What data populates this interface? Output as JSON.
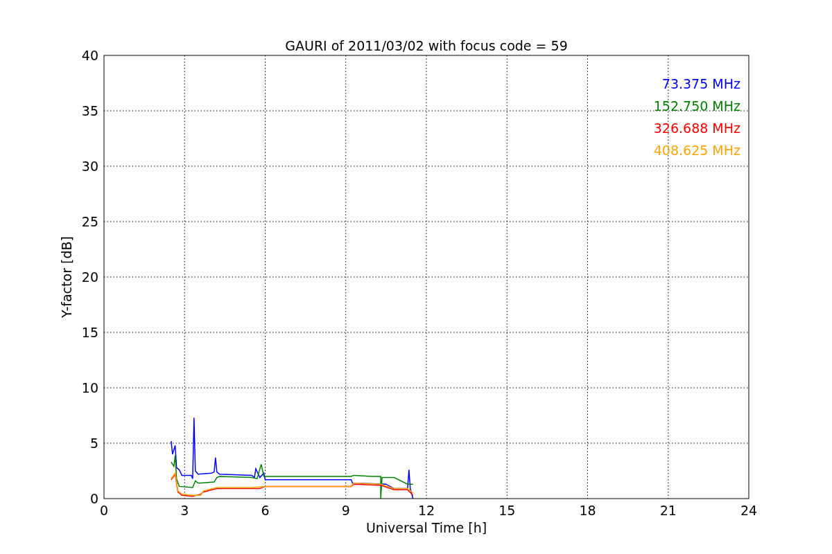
{
  "chart_data": {
    "type": "line",
    "title": "GAURI of 2011/03/02 with focus code = 59",
    "xlabel": "Universal Time [h]",
    "ylabel": "Y-factor [dB]",
    "xlim": [
      0,
      24
    ],
    "ylim": [
      0,
      40
    ],
    "xticks": [
      0,
      3,
      6,
      9,
      12,
      15,
      18,
      21,
      24
    ],
    "yticks": [
      0,
      5,
      10,
      15,
      20,
      25,
      30,
      35,
      40
    ],
    "grid": true,
    "series": [
      {
        "name": "73.375 MHz",
        "color": "#0000ff",
        "x": [
          2.5,
          2.55,
          2.65,
          2.7,
          2.8,
          2.9,
          3.25,
          3.3,
          3.35,
          3.4,
          3.5,
          4.0,
          4.1,
          4.15,
          4.2,
          4.3,
          5.5,
          5.6,
          5.65,
          5.8,
          5.95,
          6.0,
          9.2,
          9.25,
          10.5,
          10.8,
          11.3,
          11.35,
          11.4,
          11.5
        ],
        "values": [
          5.2,
          4,
          4.8,
          2.8,
          2.6,
          2.1,
          2.1,
          1.8,
          7.3,
          2.5,
          2.2,
          2.3,
          2.4,
          3.7,
          2.4,
          2.2,
          2.1,
          1.9,
          2.7,
          1.9,
          2.3,
          1.7,
          1.7,
          1.4,
          1.3,
          0.9,
          0.9,
          2.6,
          0.9,
          0
        ]
      },
      {
        "name": "152.750 MHz",
        "color": "#008000",
        "x": [
          2.5,
          2.6,
          2.65,
          2.7,
          2.8,
          3.3,
          3.4,
          3.5,
          3.6,
          4.1,
          4.2,
          4.3,
          5.5,
          5.7,
          5.85,
          5.95,
          9.2,
          9.3,
          10.0,
          10.3,
          10.3,
          10.35,
          10.8,
          11.3,
          11.5
        ],
        "values": [
          3.3,
          2.9,
          3.9,
          1.8,
          1.1,
          1,
          1.6,
          1.4,
          1.4,
          1.5,
          1.9,
          2.0,
          1.9,
          1.8,
          3.1,
          2.0,
          2.0,
          2.1,
          2.0,
          2.0,
          0,
          1.9,
          1.9,
          1.3,
          1.3
        ]
      },
      {
        "name": "326.688 MHz",
        "color": "#ff0000",
        "x": [
          2.5,
          2.65,
          2.75,
          2.9,
          3.3,
          3.6,
          3.7,
          4.2,
          5.5,
          5.8,
          6.0,
          9.2,
          9.3,
          10.3,
          10.8,
          11.3,
          11.5
        ],
        "values": [
          1.7,
          2.2,
          0.6,
          0.3,
          0.2,
          0.4,
          0.6,
          0.9,
          0.9,
          0.9,
          1.1,
          1.1,
          1.3,
          1.2,
          0.8,
          0.8,
          0.3
        ]
      },
      {
        "name": "408.625 MHz",
        "color": "#ffa500",
        "x": [
          2.5,
          2.65,
          2.75,
          2.9,
          3.3,
          3.6,
          3.7,
          4.2,
          5.5,
          6.0,
          9.2,
          9.3,
          10.3,
          10.8,
          11.3,
          11.5
        ],
        "values": [
          1.8,
          2.3,
          0.7,
          0.4,
          0.3,
          0.3,
          0.7,
          1.0,
          1.0,
          1.1,
          1.1,
          1.4,
          1.3,
          0.9,
          0.9,
          0.5
        ]
      }
    ]
  }
}
